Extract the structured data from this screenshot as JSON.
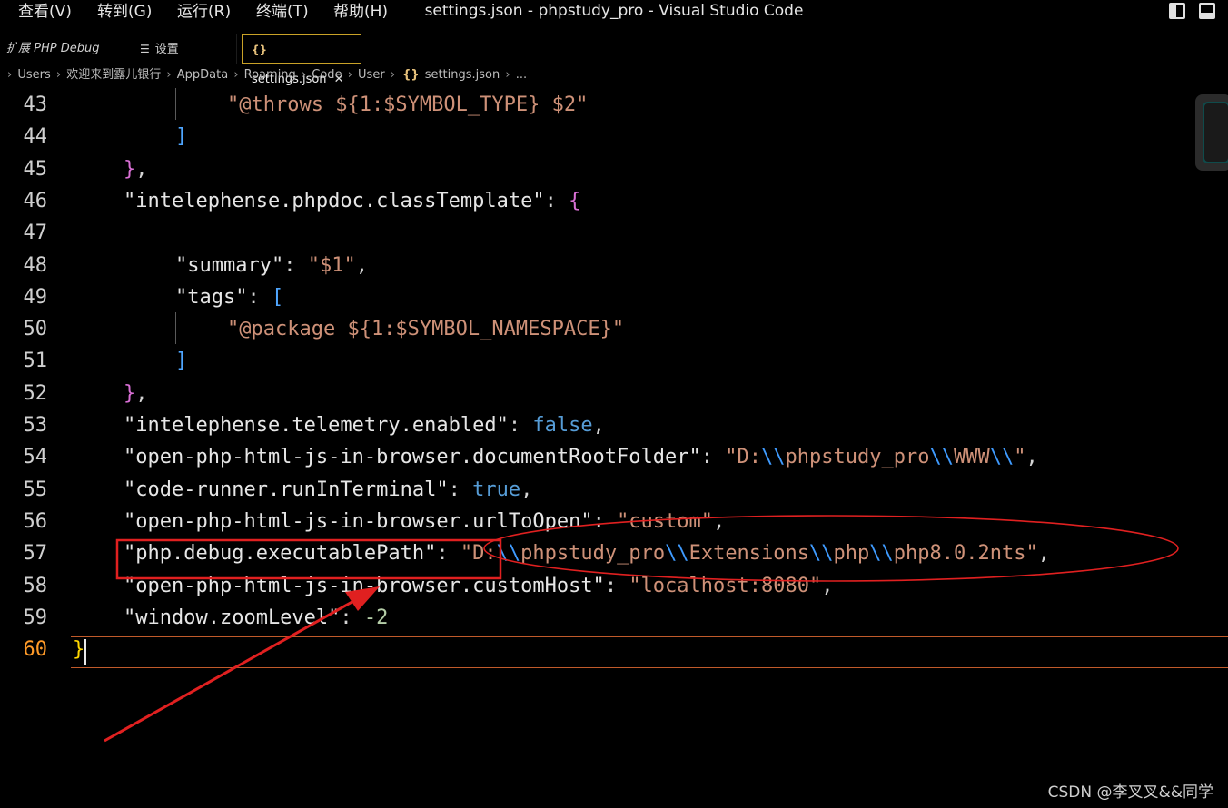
{
  "menu": [
    {
      "label": "查看(V)"
    },
    {
      "label": "转到(G)"
    },
    {
      "label": "运行(R)"
    },
    {
      "label": "终端(T)"
    },
    {
      "label": "帮助(H)"
    }
  ],
  "window_title": "settings.json - phpstudy_pro - Visual Studio Code",
  "tabs": [
    {
      "label": "扩展 PHP Debug"
    },
    {
      "label": "设置",
      "icon": "list-icon"
    },
    {
      "label": "settings.json",
      "icon": "json-braces-icon",
      "active": true
    }
  ],
  "tab_close_symbol": "✕",
  "breadcrumb": [
    "Users",
    "欢迎来到露儿银行",
    "AppData",
    "Roaming",
    "Code",
    "User",
    "settings.json",
    "..."
  ],
  "editor": {
    "current_line": "60",
    "lines": [
      {
        "n": "43",
        "s": "\"@throws ${1:$SYMBOL_TYPE} $2\""
      },
      {
        "n": "44",
        "s": "]"
      },
      {
        "n": "45",
        "p": "}",
        "c": ","
      },
      {
        "n": "46",
        "k": "\"intelephense.phpdoc.classTemplate\"",
        "p": ": ",
        "b": "{"
      },
      {
        "n": "47"
      },
      {
        "n": "48",
        "k": "\"summary\"",
        "p": ": ",
        "s": "\"$1\"",
        "c": ","
      },
      {
        "n": "49",
        "k": "\"tags\"",
        "p": ": ",
        "b": "["
      },
      {
        "n": "50",
        "s": "\"@package ${1:$SYMBOL_NAMESPACE}\""
      },
      {
        "n": "51",
        "s": "]"
      },
      {
        "n": "52",
        "p": "}",
        "c": ","
      },
      {
        "n": "53",
        "k": "\"intelephense.telemetry.enabled\"",
        "p": ": ",
        "v": "false",
        "c": ","
      },
      {
        "n": "54",
        "k": "\"open-php-html-js-in-browser.documentRootFolder\"",
        "p": ": ",
        "s": "\"D:\\\\phpstudy_pro\\\\WWW\\\\\"",
        "c": ","
      },
      {
        "n": "55",
        "k": "\"code-runner.runInTerminal\"",
        "p": ": ",
        "v": "true",
        "c": ","
      },
      {
        "n": "56",
        "k": "\"open-php-html-js-in-browser.urlToOpen\"",
        "p": ": ",
        "s": "\"custom\"",
        "c": ","
      },
      {
        "n": "57",
        "k": "\"php.debug.executablePath\"",
        "p": ": ",
        "s": "\"D:\\\\phpstudy_pro\\\\Extensions\\\\php\\\\php8.0.2nts\"",
        "c": ","
      },
      {
        "n": "58",
        "k": "\"open-php-html-js-in-browser.customHost\"",
        "p": ": ",
        "s": "\"localhost:8080\"",
        "c": ","
      },
      {
        "n": "59",
        "k": "\"window.zoomLevel\"",
        "p": ": ",
        "num": "-2"
      },
      {
        "n": "60",
        "b": "}"
      }
    ]
  },
  "colors": {
    "string": "#ce9178",
    "escape": "#3f9bff",
    "boolean": "#569cd6",
    "number": "#b5cea8",
    "current_line_number": "#ff9a28",
    "annotation_red": "#e02020"
  },
  "watermark": "CSDN @李叉叉&&同学"
}
